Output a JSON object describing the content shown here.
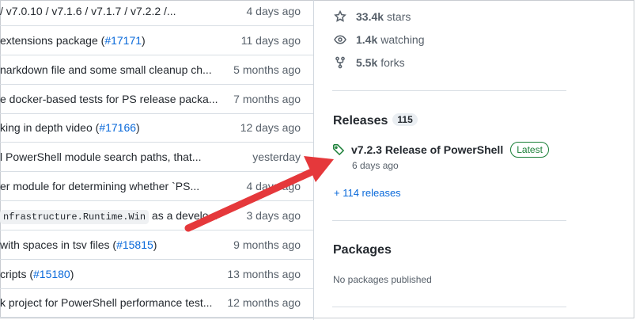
{
  "commits": [
    {
      "text": "/ v7.0.10 / v7.1.6 / v7.1.7 / v7.2.2 /...",
      "age": "4 days ago"
    },
    {
      "text": "extensions package (",
      "link": "#17171",
      "tail": ")",
      "age": "11 days ago"
    },
    {
      "text": "narkdown file and some small cleanup ch...",
      "age": "5 months ago"
    },
    {
      "text": "e docker-based tests for PS release packa...",
      "age": "7 months ago"
    },
    {
      "text": "king in depth video (",
      "link": "#17166",
      "tail": ")",
      "age": "12 days ago"
    },
    {
      "text": "l PowerShell module search paths, that...",
      "age": "yesterday"
    },
    {
      "text": "er module for determining whether `PS...",
      "age": "4 days ago"
    },
    {
      "code": "nfrastructure.Runtime.Win",
      "text": " as a develo...",
      "age": "3 days ago"
    },
    {
      "text": "with spaces in tsv files (",
      "link": "#15815",
      "tail": ")",
      "age": "9 months ago"
    },
    {
      "text": "cripts (",
      "link": "#15180",
      "tail": ")",
      "age": "13 months ago"
    },
    {
      "text": "k project for PowerShell performance test...",
      "age": "12 months ago"
    }
  ],
  "about": {
    "stars_count": "33.4k",
    "stars_label": "stars",
    "watching_count": "1.4k",
    "watching_label": "watching",
    "forks_count": "5.5k",
    "forks_label": "forks"
  },
  "releases": {
    "title": "Releases",
    "count": "115",
    "latest_name": "v7.2.3 Release of PowerShell",
    "latest_badge": "Latest",
    "latest_date": "6 days ago",
    "more_link": "+ 114 releases"
  },
  "packages": {
    "title": "Packages",
    "empty_text": "No packages published"
  },
  "colors": {
    "link": "#0969da",
    "latest_green": "#1a7f37",
    "arrow_red": "#e5383b"
  }
}
